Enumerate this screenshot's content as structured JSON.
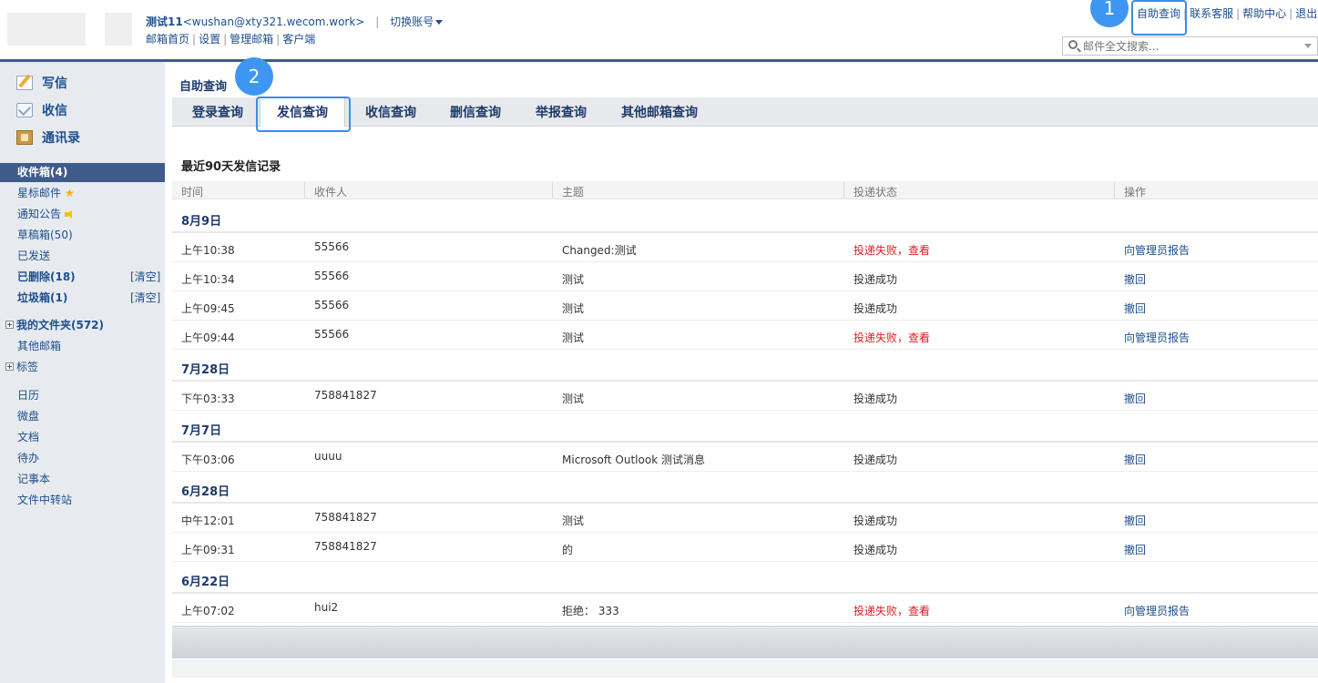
{
  "header": {
    "user_name": "测试11",
    "email": "<wushan@xty321.wecom.work>",
    "switch_account": "切换账号",
    "links": [
      "邮箱首页",
      "设置",
      "管理邮箱",
      "客户端"
    ],
    "top_links": [
      "自助查询",
      "联系客服",
      "帮助中心",
      "退出"
    ],
    "search_placeholder": "邮件全文搜索..."
  },
  "annotations": {
    "badge1": "1",
    "badge2": "2"
  },
  "sidebar": {
    "write": "写信",
    "receive": "收信",
    "contacts": "通讯录",
    "inbox": "收件箱(4)",
    "starred": "星标邮件",
    "notices": "通知公告",
    "drafts": "草稿箱(50)",
    "sent": "已发送",
    "deleted": "已删除(18)",
    "spam": "垃圾箱(1)",
    "clear": "[清空]",
    "my_folders": "我的文件夹(572)",
    "other_mailboxes": "其他邮箱",
    "tags": "标签",
    "calendar": "日历",
    "disk": "微盘",
    "docs": "文档",
    "todo": "待办",
    "notes": "记事本",
    "file_transfer": "文件中转站"
  },
  "main": {
    "page_title": "自助查询",
    "tabs": [
      "登录查询",
      "发信查询",
      "收信查询",
      "删信查询",
      "举报查询",
      "其他邮箱查询"
    ],
    "section_title": "最近90天发信记录",
    "columns": [
      "时间",
      "收件人",
      "主题",
      "投递状态",
      "操作"
    ],
    "groups": [
      {
        "date": "8月9日",
        "rows": [
          {
            "time": "上午10:38",
            "to": "55566",
            "subject": "Changed:测试",
            "status": "投递失败，查看",
            "fail": true,
            "action": "向管理员报告"
          },
          {
            "time": "上午10:34",
            "to": "55566",
            "subject": "测试",
            "status": "投递成功",
            "fail": false,
            "action": "撤回"
          },
          {
            "time": "上午09:45",
            "to": "55566",
            "subject": "测试",
            "status": "投递成功",
            "fail": false,
            "action": "撤回"
          },
          {
            "time": "上午09:44",
            "to": "55566",
            "subject": "测试",
            "status": "投递失败，查看",
            "fail": true,
            "action": "向管理员报告"
          }
        ]
      },
      {
        "date": "7月28日",
        "rows": [
          {
            "time": "下午03:33",
            "to": "758841827",
            "subject": "测试",
            "status": "投递成功",
            "fail": false,
            "action": "撤回"
          }
        ]
      },
      {
        "date": "7月7日",
        "rows": [
          {
            "time": "下午03:06",
            "to": "uuuu",
            "subject": "Microsoft Outlook 测试消息",
            "status": "投递成功",
            "fail": false,
            "action": "撤回"
          }
        ]
      },
      {
        "date": "6月28日",
        "rows": [
          {
            "time": "中午12:01",
            "to": "758841827",
            "subject": "测试",
            "status": "投递成功",
            "fail": false,
            "action": "撤回"
          },
          {
            "time": "上午09:31",
            "to": "758841827",
            "subject": "的",
            "status": "投递成功",
            "fail": false,
            "action": "撤回"
          }
        ]
      },
      {
        "date": "6月22日",
        "rows": [
          {
            "time": "上午07:02",
            "to": "hui2",
            "subject": "拒绝： 333",
            "status": "投递失败，查看",
            "fail": true,
            "action": "向管理员报告"
          }
        ]
      }
    ]
  },
  "colors": {
    "accent": "#3e5b8b",
    "link": "#1e4e8c",
    "fail": "#e02020",
    "highlight": "#3a8de6"
  }
}
